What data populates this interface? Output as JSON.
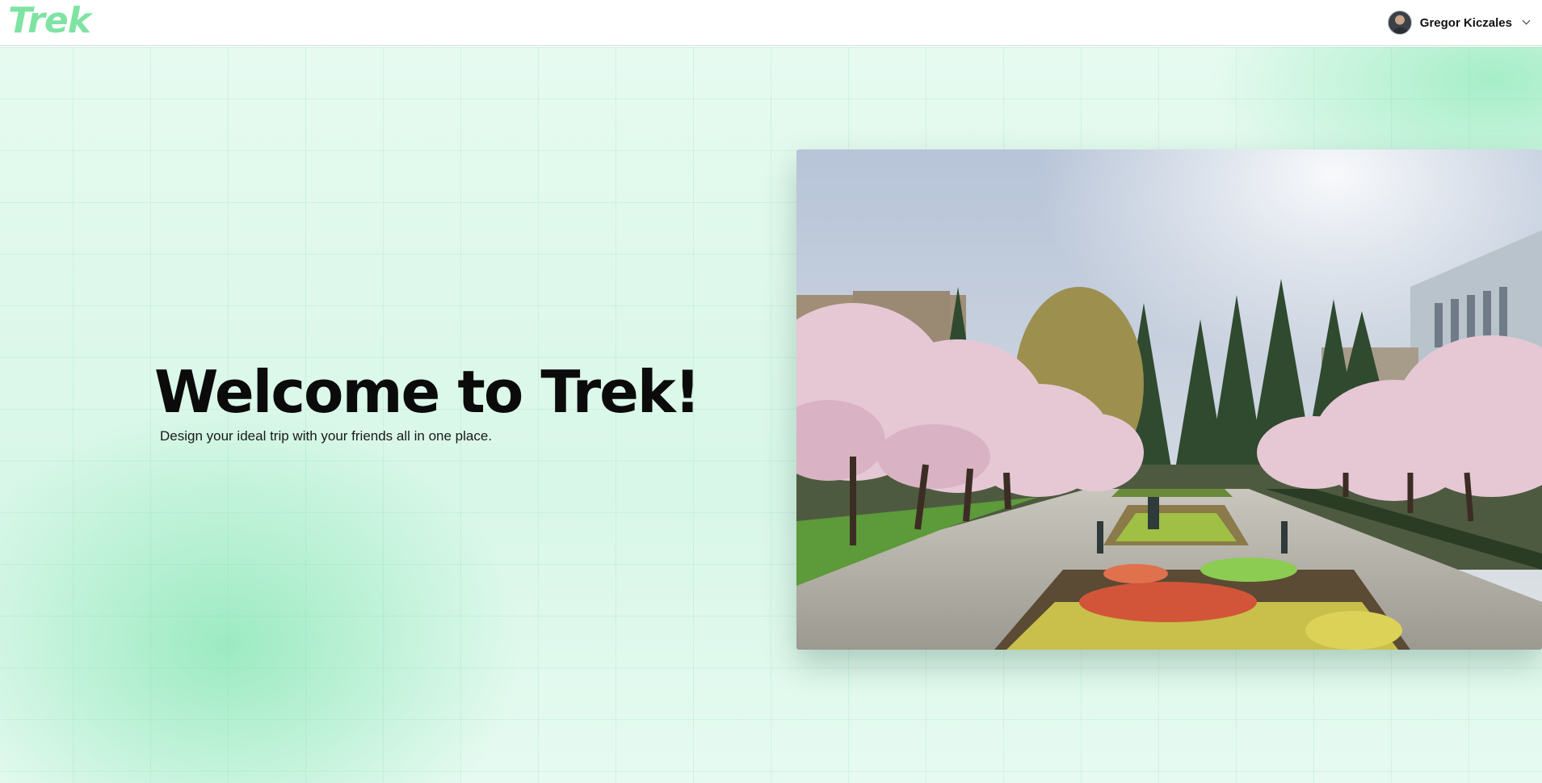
{
  "header": {
    "logo_text": "Trek",
    "user": {
      "name": "Gregor Kiczales",
      "avatar_icon": "user-avatar",
      "menu_icon": "chevron-down-icon"
    }
  },
  "hero": {
    "title": "Welcome to Trek!",
    "subtitle": "Design your ideal trip with your friends all in one place.",
    "image_icon": "campus-walkway-photo"
  },
  "colors": {
    "brand": "#7fe3a3",
    "background": "#e2f9ee"
  }
}
